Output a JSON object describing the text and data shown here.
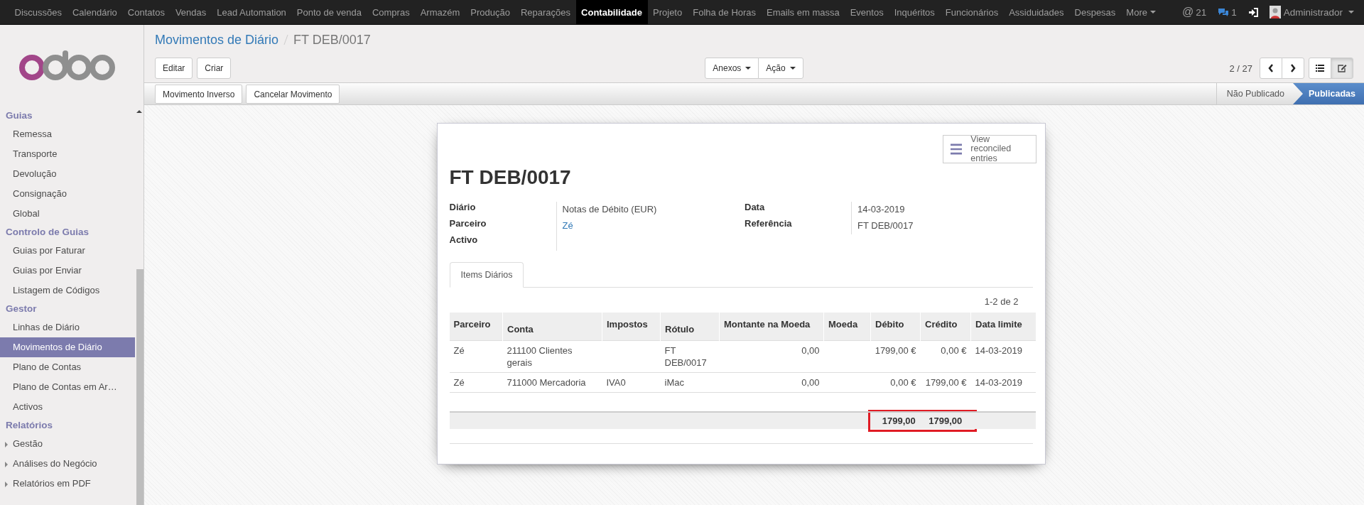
{
  "top_menu": {
    "items": [
      {
        "label": "Discussões",
        "selected": false
      },
      {
        "label": "Calendário",
        "selected": false
      },
      {
        "label": "Contatos",
        "selected": false
      },
      {
        "label": "Vendas",
        "selected": false
      },
      {
        "label": "Lead Automation",
        "selected": false
      },
      {
        "label": "Ponto de venda",
        "selected": false
      },
      {
        "label": "Compras",
        "selected": false
      },
      {
        "label": "Armazém",
        "selected": false
      },
      {
        "label": "Produção",
        "selected": false
      },
      {
        "label": "Reparações",
        "selected": false
      },
      {
        "label": "Contabilidade",
        "selected": true
      },
      {
        "label": "Projeto",
        "selected": false
      },
      {
        "label": "Folha de Horas",
        "selected": false
      },
      {
        "label": "Emails em massa",
        "selected": false
      },
      {
        "label": "Eventos",
        "selected": false
      },
      {
        "label": "Inquéritos",
        "selected": false
      },
      {
        "label": "Funcionários",
        "selected": false
      },
      {
        "label": "Assiduidades",
        "selected": false
      },
      {
        "label": "Despesas",
        "selected": false
      }
    ],
    "more": "More",
    "mentions": {
      "symbol": "@",
      "count": "21"
    },
    "messages_count": "1",
    "user": "Administrador"
  },
  "sidebar": {
    "sections": [
      {
        "title": "Guias",
        "items": [
          {
            "label": "Remessa",
            "selected": false,
            "has_children": false
          },
          {
            "label": "Transporte",
            "selected": false,
            "has_children": false
          },
          {
            "label": "Devolução",
            "selected": false,
            "has_children": false
          },
          {
            "label": "Consignação",
            "selected": false,
            "has_children": false
          },
          {
            "label": "Global",
            "selected": false,
            "has_children": false
          }
        ]
      },
      {
        "title": "Controlo de Guias",
        "items": [
          {
            "label": "Guias por Faturar",
            "selected": false,
            "has_children": false
          },
          {
            "label": "Guias por Enviar",
            "selected": false,
            "has_children": false
          },
          {
            "label": "Listagem de Códigos",
            "selected": false,
            "has_children": false
          }
        ]
      },
      {
        "title": "Gestor",
        "items": [
          {
            "label": "Linhas de Diário",
            "selected": false,
            "has_children": false
          },
          {
            "label": "Movimentos de Diário",
            "selected": true,
            "has_children": false
          },
          {
            "label": "Plano de Contas",
            "selected": false,
            "has_children": false
          },
          {
            "label": "Plano de Contas em Ar…",
            "selected": false,
            "has_children": false
          },
          {
            "label": "Activos",
            "selected": false,
            "has_children": false
          }
        ]
      },
      {
        "title": "Relatórios",
        "items": [
          {
            "label": "Gestão",
            "selected": false,
            "has_children": true
          },
          {
            "label": "Análises do Negócio",
            "selected": false,
            "has_children": true
          },
          {
            "label": "Relatórios em PDF",
            "selected": false,
            "has_children": true
          }
        ]
      }
    ]
  },
  "breadcrumb": {
    "parent": "Movimentos de Diário",
    "current": "FT DEB/0017"
  },
  "buttons": [
    "Editar",
    "Criar"
  ],
  "dropdowns": [
    "Anexos",
    "Ação"
  ],
  "pager": "2 / 27",
  "views": [
    {
      "kind": "list",
      "selected": false
    },
    {
      "kind": "form",
      "selected": true
    }
  ],
  "action_buttons": [
    "Movimento Inverso",
    "Cancelar Movimento"
  ],
  "stages": [
    {
      "label": "Não Publicado",
      "selected": false
    },
    {
      "label": "Publicadas",
      "selected": true
    }
  ],
  "form": {
    "smart_button": "View reconciled entries",
    "title": "FT DEB/0017",
    "left_fields": [
      {
        "label": "Diário",
        "value": "Notas de Débito (EUR)",
        "link": false
      },
      {
        "label": "Parceiro",
        "value": "Zé",
        "link": true
      },
      {
        "label": "Activo"
      }
    ],
    "right_fields": [
      {
        "label": "Data",
        "value": "14-03-2019",
        "link": false
      },
      {
        "label": "Referência",
        "value": "FT DEB/0017",
        "link": false
      }
    ],
    "tabs": [
      {
        "label": "Items Diários",
        "selected": true
      }
    ],
    "table": {
      "pager": "1-2 de 2",
      "columns": [
        "Parceiro",
        "Conta",
        "Impostos",
        "Rótulo",
        "Montante na Moeda",
        "Moeda",
        "Débito",
        "Crédito",
        "Data limite"
      ],
      "rows": [
        [
          "Zé",
          "211100 Clientes gerais",
          "",
          "FT DEB/0017",
          "0,00",
          "",
          "1799,00 €",
          "0,00 €",
          "14-03-2019"
        ],
        [
          "Zé",
          "711000 Mercadoria",
          "IVA0",
          "iMac",
          "0,00",
          "",
          "0,00 €",
          "1799,00 €",
          "14-03-2019"
        ]
      ],
      "totals": {
        "debit": "1799,00",
        "credit": "1799,00"
      },
      "highlighted_totals": true
    }
  }
}
